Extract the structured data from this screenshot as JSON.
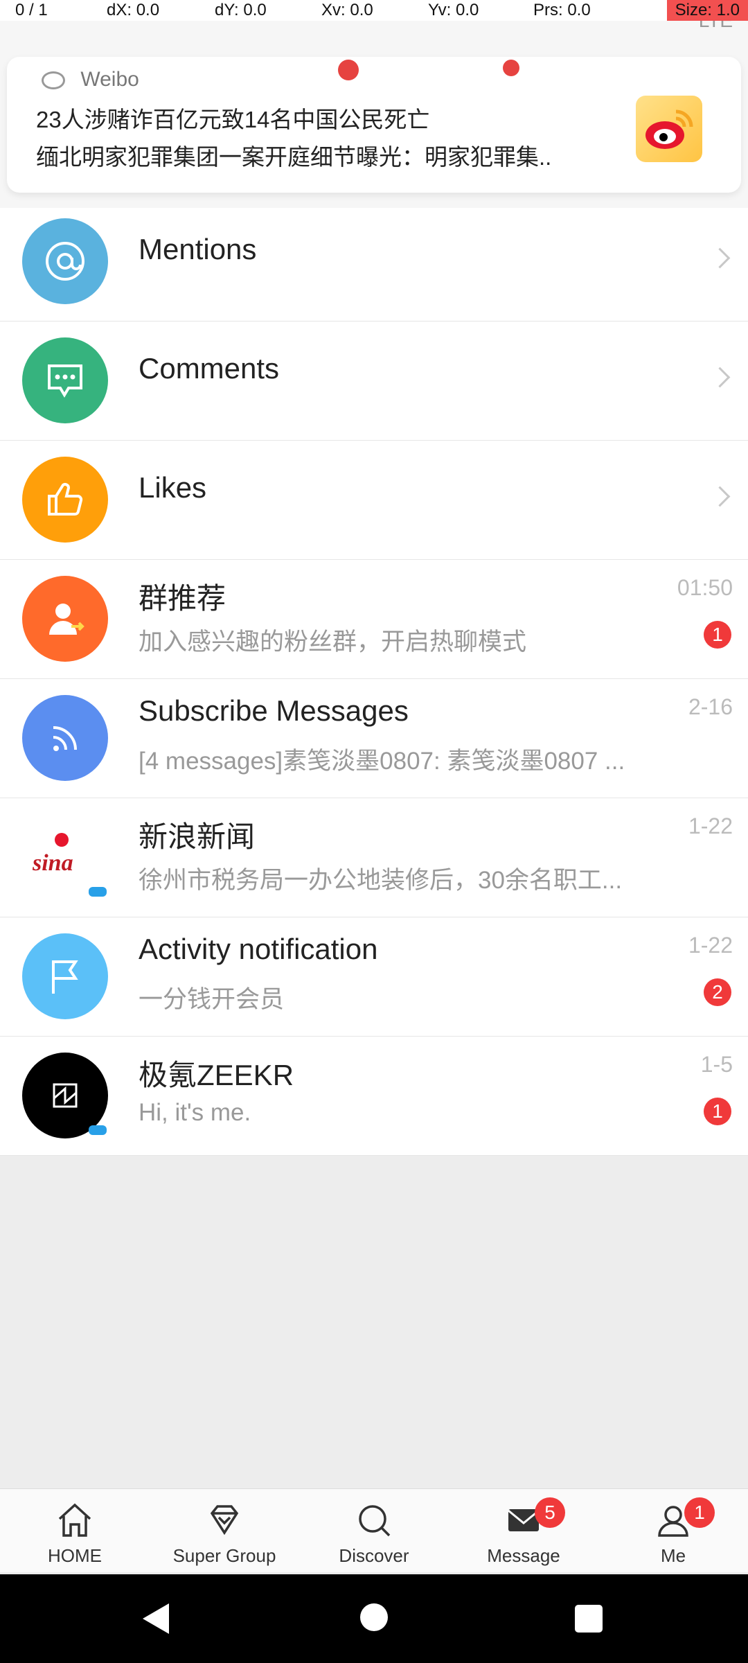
{
  "debug": {
    "pointer": "0 / 1",
    "dx": "dX: 0.0",
    "dy": "dY: 0.0",
    "xv": "Xv: 0.0",
    "yv": "Yv: 0.0",
    "prs": "Prs: 0.0",
    "size": "Size: 1.0"
  },
  "notification": {
    "app_name": "Weibo",
    "status_right": "LTE",
    "line1": "23人涉赌诈百亿元致14名中国公民死亡",
    "line2": "缅北明家犯罪集团一案开庭细节曝光：明家犯罪集..",
    "icon": "weibo-icon"
  },
  "messages": [
    {
      "title": "Mentions",
      "subtitle": "",
      "time": "",
      "badge": "",
      "icon": "at-icon",
      "color": "#5ab2de"
    },
    {
      "title": "Comments",
      "subtitle": "",
      "time": "",
      "badge": "",
      "icon": "chat-bubble-icon",
      "color": "#36b37e"
    },
    {
      "title": "Likes",
      "subtitle": "",
      "time": "",
      "badge": "",
      "icon": "thumbs-up-icon",
      "color": "#ff9f0a"
    },
    {
      "title": "群推荐",
      "subtitle": "加入感兴趣的粉丝群，开启热聊模式",
      "time": "01:50",
      "badge": "1",
      "icon": "group-recommend-icon",
      "color": "#ff6a2b"
    },
    {
      "title": "Subscribe Messages",
      "subtitle": "[4 messages]素笺淡墨0807: 素笺淡墨0807 ...",
      "time": "2-16",
      "badge": "",
      "icon": "rss-icon",
      "color": "#5b8ef0"
    },
    {
      "title": "新浪新闻",
      "subtitle": "徐州市税务局一办公地装修后，30余名职工...",
      "time": "1-22",
      "badge": "",
      "icon": "sina-logo-icon",
      "color": "#ffffff"
    },
    {
      "title": "Activity notification",
      "subtitle": "一分钱开会员",
      "time": "1-22",
      "badge": "2",
      "icon": "flag-icon",
      "color": "#5bc0f8"
    },
    {
      "title": "极氪ZEEKR",
      "subtitle": "Hi, it's me.",
      "time": "1-5",
      "badge": "1",
      "icon": "zeekr-logo-icon",
      "color": "#000000"
    }
  ],
  "tabs": [
    {
      "label": "HOME",
      "icon": "home-icon",
      "badge": ""
    },
    {
      "label": "Super Group",
      "icon": "diamond-icon",
      "badge": ""
    },
    {
      "label": "Discover",
      "icon": "search-icon",
      "badge": ""
    },
    {
      "label": "Message",
      "icon": "envelope-icon",
      "badge": "5"
    },
    {
      "label": "Me",
      "icon": "person-icon",
      "badge": "1"
    }
  ]
}
